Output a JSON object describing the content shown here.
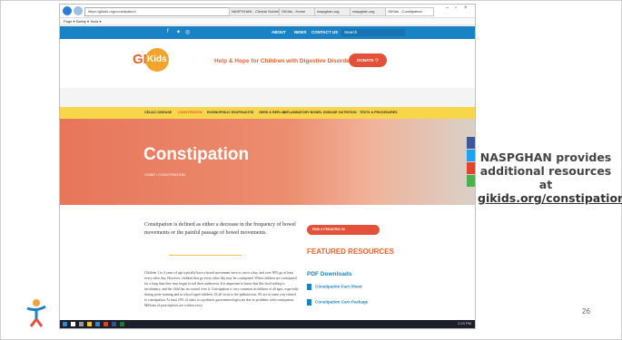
{
  "browser": {
    "url": "https://gikids.org/constipation/",
    "tabs": [
      {
        "label": "NASPGHAN - Clinical Guidelin...",
        "active": false
      },
      {
        "label": "GIKids - Home",
        "active": false
      },
      {
        "label": "naspghan.org",
        "active": false
      },
      {
        "label": "naspghan.org",
        "active": false
      },
      {
        "label": "GIKids - Constipation",
        "active": true
      }
    ],
    "favorites_text": "Page ▾  Safety ▾  Tools ▾"
  },
  "site": {
    "top_nav": {
      "links": [
        "ABOUT",
        "NEWS",
        "CONTACT US"
      ],
      "search_placeholder": "Search"
    },
    "logo_text": "GI",
    "logo_circle": "Kids",
    "tagline": "Help & Hope for Children with Digestive Disorders",
    "donate_label": "DONATE",
    "menu": [
      "CELIAC DISEASE",
      "CONSTIPATION",
      "EOSINOPHILIC ESOPHAGITIS",
      "GERD & REFLUX",
      "INFLAMMATORY BOWEL DISEASE",
      "NUTRITION",
      "TESTS & PROCEDURES"
    ],
    "active_menu": "CONSTIPATION",
    "hero_title": "Constipation",
    "breadcrumb": "HOME / CONSTIPATION",
    "intro": "Constipation is defined as either a decrease in the frequency of bowel movements or the painful passage of bowel movements.",
    "body": "Children 1 to 4 years of age typically have a bowel movement once or twice a day, and over 90% go at least every other day. However, children that go every other day may be constipated. When children are constipated for a long time they may begin to soil their underwear. It is important to know that this fecal soiling is involuntary, and the child has no control over it. Constipation is very common in children of all ages, especially during potty-training and in school-aged children. Of all visits to the pediatrician, 3% are in some way related to constipation. At least 25% of visits to a pediatric gastroenterologist are due to problems with constipation. Millions of prescriptions are written every",
    "find_button": "FIND A PEDIATRIC GI",
    "featured_heading": "FEATURED RESOURCES",
    "pdf_heading": "PDF Downloads",
    "pdf_items": [
      "Constipation Fact Sheet",
      "Constipation Care Package"
    ],
    "taskbar_time": "2:20 PM"
  },
  "slide": {
    "note_line1": "NASPGHAN provides",
    "note_line2": "additional resources at",
    "note_link": "gikids.org/constipation",
    "page_number": "26"
  },
  "colors": {
    "accent": "#e8622e",
    "blue": "#1a83c6",
    "yellow": "#f7d64a"
  }
}
